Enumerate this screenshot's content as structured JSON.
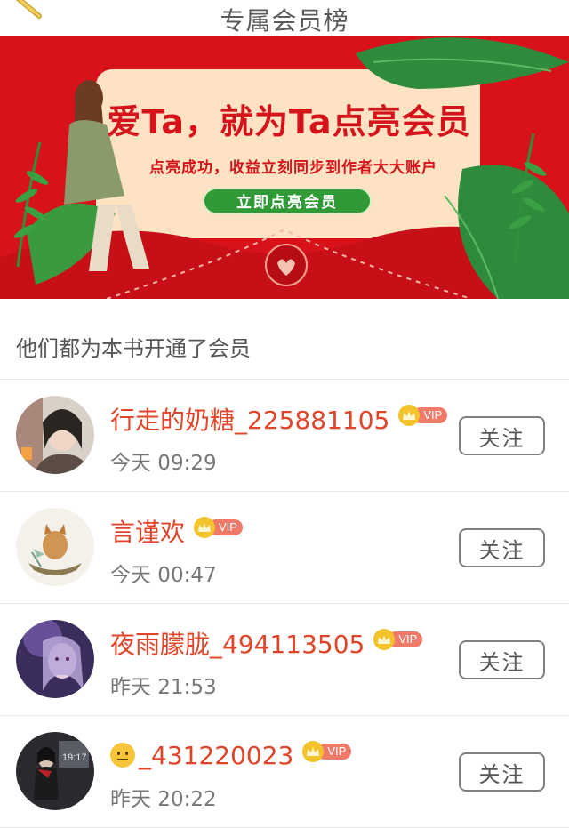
{
  "header": {
    "title": "专属会员榜",
    "left_icon": "pencil-icon"
  },
  "banner": {
    "headline": "爱Ta，就为Ta点亮会员",
    "subtitle": "点亮成功，收益立刻同步到作者大大账户",
    "cta_label": "立即点亮会员",
    "colors": {
      "background": "#d8121b",
      "card": "#fde3c4",
      "cta": "#2f9a36"
    }
  },
  "section_title": "他们都为本书开通了会员",
  "members": [
    {
      "name": "行走的奶糖_225881105",
      "time": "今天 09:29",
      "badge": "VIP",
      "follow_label": "关注",
      "avatar": "girl-portrait-avatar"
    },
    {
      "name": "言谨欢",
      "time": "今天 00:47",
      "badge": "VIP",
      "follow_label": "关注",
      "avatar": "cat-boat-avatar"
    },
    {
      "name": "夜雨朦胧_494113505",
      "time": "昨天 21:53",
      "badge": "VIP",
      "follow_label": "关注",
      "avatar": "purple-portrait-avatar"
    },
    {
      "name": "_431220023",
      "name_prefix_icon": "neutral-face-emoji",
      "time": "昨天 20:22",
      "badge": "VIP",
      "follow_label": "关注",
      "avatar": "night-scene-avatar"
    }
  ]
}
